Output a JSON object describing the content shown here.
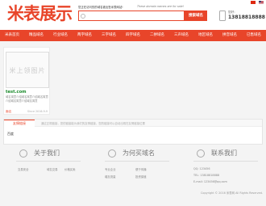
{
  "header": {
    "logo_text": "米表展示",
    "slogan_cn": "您正在访问的的域名被出售米表网站!",
    "slogan_en": "These domain names are for sale!",
    "search_placeholder": "",
    "search_button": "搜索域名",
    "phone_label": "您好：",
    "phone_number": "13818818888",
    "accent_color": "#e8452a"
  },
  "nav": {
    "items": [
      "米表首页",
      "精品域名",
      "行业域名",
      "两字域名",
      "三字域名",
      "四字域名",
      "二拼域名",
      "三声域名",
      "地区域名",
      "拼音域名",
      "已售域名"
    ]
  },
  "product": {
    "image_text": "米上领图片",
    "name": "test.com",
    "description": "域名寓意介绍域名寓意介绍域名寓意介绍域名寓意介绍域名寓意",
    "price": "面议",
    "date": "Since 2016-9-9"
  },
  "links": {
    "title": "友情链接",
    "notice": "通过正规链接，您的链接能为我们的友情链接，您的链接可以自动出现在友情链接位置",
    "items": [
      "百度"
    ]
  },
  "footer": {
    "about": {
      "title": "关于我们",
      "links": [
        "交易安全",
        "域名交易",
        "价格买卖"
      ]
    },
    "how": {
      "title": "为何买域名",
      "links": [
        "专业企业",
        "便于传播",
        "增加流量",
        "投资保值"
      ]
    },
    "contact": {
      "title": "联系我们",
      "qq": "QQ: 123456",
      "phone": "TEL: 13818818888",
      "email": "E-mail: 123456@qq.com"
    },
    "copyright": "Copyright © 2016 米表网 All Rights Reserved."
  }
}
